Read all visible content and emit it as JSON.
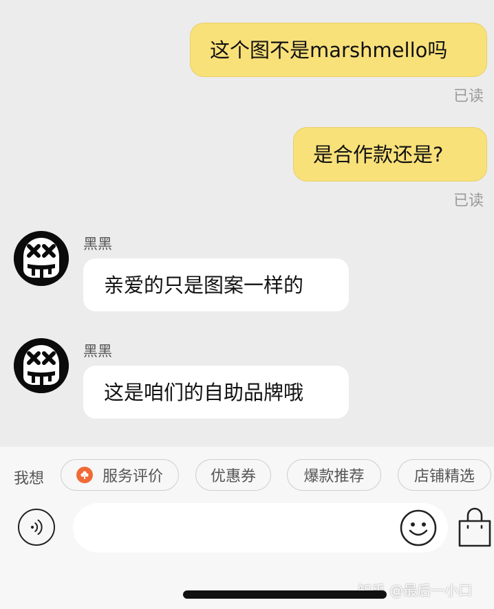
{
  "messages": [
    {
      "dir": "out",
      "text": "这个图不是marshmello吗",
      "status": "已读"
    },
    {
      "dir": "out",
      "text": "是合作款还是?",
      "status": "已读"
    },
    {
      "dir": "in",
      "sender": "黑黑",
      "text": "亲爱的只是图案一样的"
    },
    {
      "dir": "in",
      "sender": "黑黑",
      "text": "这是咱们的自助品牌哦"
    }
  ],
  "quick_bar": {
    "label": "我想",
    "chips": [
      "服务评价",
      "优惠券",
      "爆款推荐",
      "店铺精选"
    ]
  },
  "input": {
    "placeholder": ""
  },
  "icons": {
    "voice": "voice-icon",
    "emoji": "emoji-icon",
    "shop": "shopping-bag-icon",
    "rating": "rating-flower-icon"
  },
  "watermark": "知乎 @最后一小口",
  "colors": {
    "outgoing_bubble": "#f9e17a",
    "incoming_bubble": "#ffffff",
    "chat_bg": "#ececec",
    "bottom_bg": "#f7f7f7",
    "chip_accent": "#f06a35"
  }
}
